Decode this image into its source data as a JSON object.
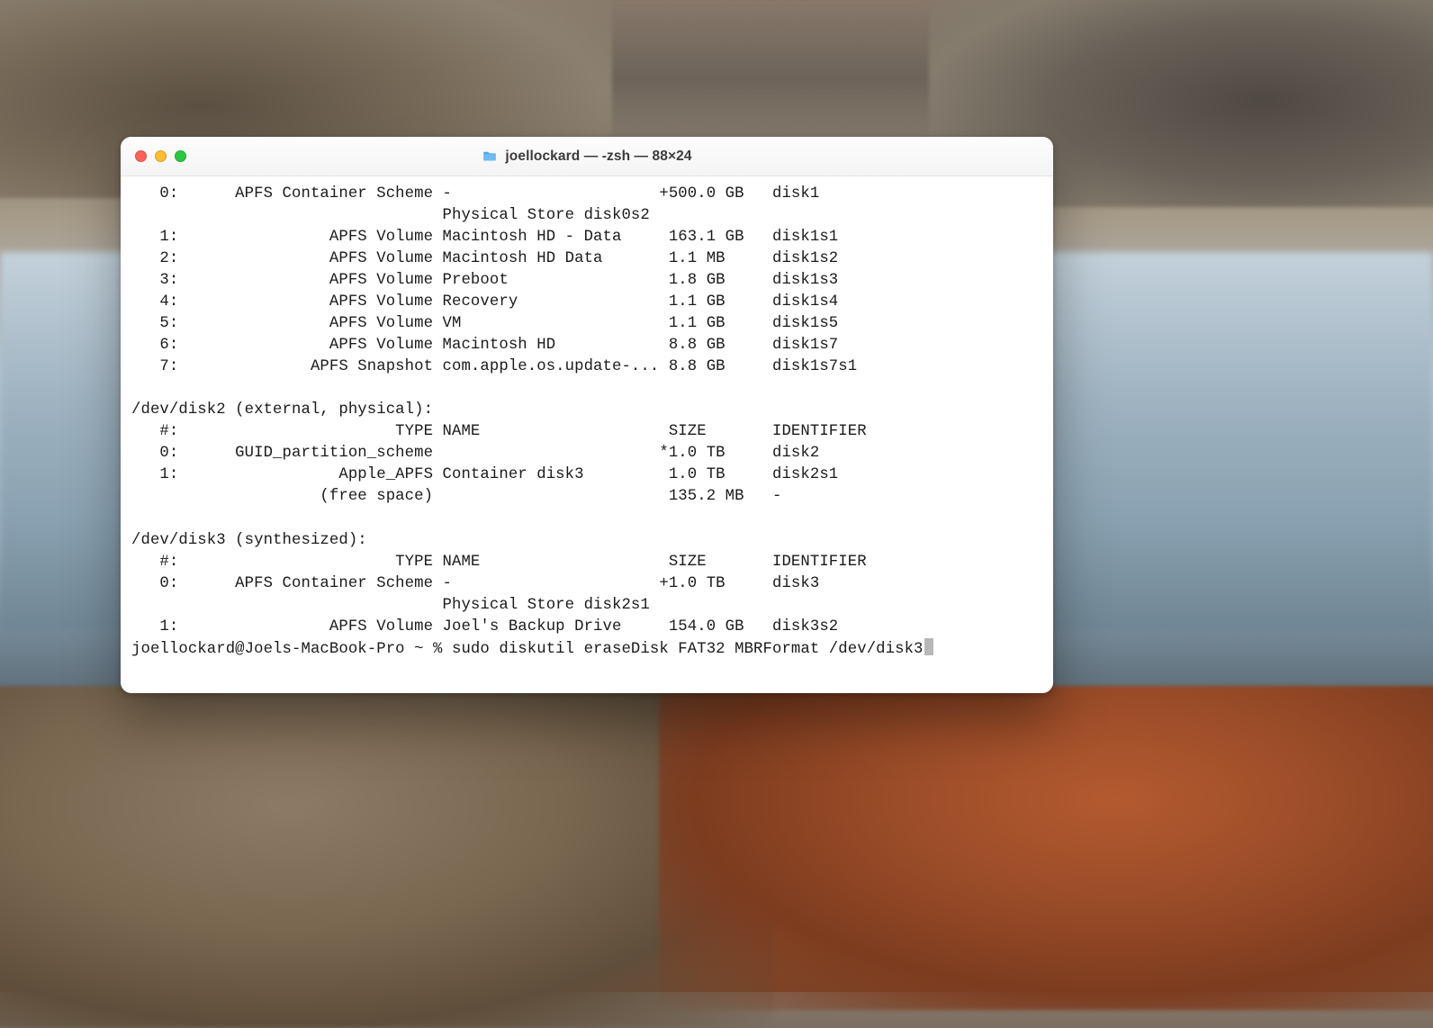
{
  "window": {
    "title": "joellockard — -zsh — 88×24"
  },
  "terminal": {
    "lines": [
      "   0:      APFS Container Scheme -                      +500.0 GB   disk1",
      "                                 Physical Store disk0s2",
      "   1:                APFS Volume Macintosh HD - Data     163.1 GB   disk1s1",
      "   2:                APFS Volume Macintosh HD Data       1.1 MB     disk1s2",
      "   3:                APFS Volume Preboot                 1.8 GB     disk1s3",
      "   4:                APFS Volume Recovery                1.1 GB     disk1s4",
      "   5:                APFS Volume VM                      1.1 GB     disk1s5",
      "   6:                APFS Volume Macintosh HD            8.8 GB     disk1s7",
      "   7:              APFS Snapshot com.apple.os.update-... 8.8 GB     disk1s7s1",
      "",
      "/dev/disk2 (external, physical):",
      "   #:                       TYPE NAME                    SIZE       IDENTIFIER",
      "   0:      GUID_partition_scheme                        *1.0 TB     disk2",
      "   1:                 Apple_APFS Container disk3         1.0 TB     disk2s1",
      "                    (free space)                         135.2 MB   -",
      "",
      "/dev/disk3 (synthesized):",
      "   #:                       TYPE NAME                    SIZE       IDENTIFIER",
      "   0:      APFS Container Scheme -                      +1.0 TB     disk3",
      "                                 Physical Store disk2s1",
      "   1:                APFS Volume Joel's Backup Drive     154.0 GB   disk3s2"
    ],
    "prompt": "joellockard@Joels-MacBook-Pro ~ % ",
    "command": "sudo diskutil eraseDisk FAT32 MBRFormat /dev/disk3"
  }
}
